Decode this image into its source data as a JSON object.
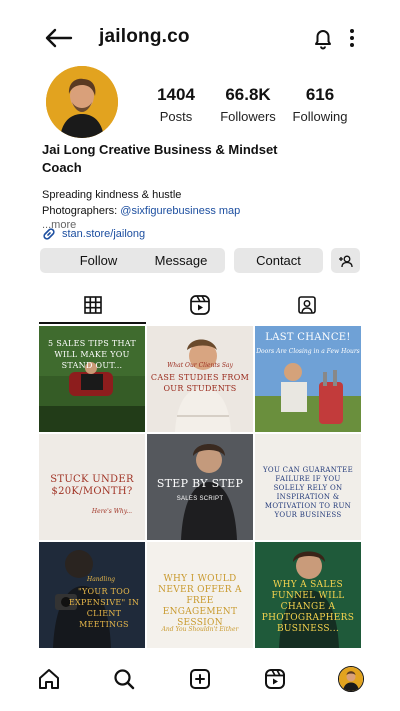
{
  "header": {
    "username": "jailong.co"
  },
  "profile": {
    "stats": [
      {
        "value": "1404",
        "label": "Posts"
      },
      {
        "value": "66.8K",
        "label": "Followers"
      },
      {
        "value": "616",
        "label": "Following"
      }
    ],
    "name_line1": "Jai Long Creative Business & Mindset",
    "name_line2": "Coach",
    "bio_line1": "Spreading kindness & hustle",
    "bio_line2_prefix": "Photographers: ",
    "bio_line2_mention": "@sixfigurebusiness map",
    "more": "...more",
    "link": "stan.store/jailong"
  },
  "buttons": {
    "follow": "Follow",
    "message": "Message",
    "contact": "Contact"
  },
  "tabs": [
    {
      "icon": "grid-icon"
    },
    {
      "icon": "reels-icon"
    },
    {
      "icon": "tagged-icon"
    }
  ],
  "posts": [
    {
      "text": "5 Sales Tips That Will Make You Stand Out...",
      "sub": "",
      "bg": "#3f6b2e",
      "fg": "#ffffff"
    },
    {
      "text": "Case Studies From Our Students",
      "sub": "What Our Clients Say",
      "bg": "#ece7e1",
      "fg": "#9a2a1c"
    },
    {
      "text": "Last Chance!",
      "sub": "Doors Are Closing in a Few Hours",
      "bg": "#5b8fc9",
      "fg": "#ffffff"
    },
    {
      "text": "Stuck Under $20K/Month?",
      "sub": "Here's Why...",
      "bg": "#efebe6",
      "fg": "#a13426"
    },
    {
      "text": "Step By Step",
      "sub": "Sales Script",
      "bg": "#4a4c50",
      "fg": "#ffffff"
    },
    {
      "text": "You Can Guarantee Failure If You Solely Rely On Inspiration & Motivation To Run Your Business",
      "sub": "",
      "bg": "#f1eee9",
      "fg": "#233a7a"
    },
    {
      "text": "\"Your Too Expensive\" In Client Meetings",
      "sub": "Handling",
      "bg": "#1f2a3a",
      "fg": "#e8b84a"
    },
    {
      "text": "Why I Would Never Offer A Free Engagement Session",
      "sub": "And You Shouldn't Either",
      "bg": "#f4f1ec",
      "fg": "#c99a2e"
    },
    {
      "text": "Why A Sales Funnel Will Change A Photographers Business...",
      "sub": "",
      "bg": "#1f5a3a",
      "fg": "#f5d34e"
    }
  ],
  "colors": {
    "link": "#1d4fa0",
    "button_bg": "#e7e7e7",
    "avatar_bg": "#e2a31f"
  }
}
